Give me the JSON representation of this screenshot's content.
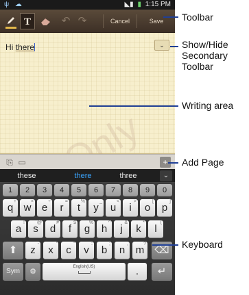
{
  "status_bar": {
    "time": "1:15 PM",
    "left_icons": "ψ ☁",
    "signal": "◣▮"
  },
  "toolbar": {
    "pen_icon": "pen-icon",
    "text_label": "T",
    "eraser_icon": "eraser-icon",
    "undo_icon": "undo-icon",
    "redo_icon": "redo-icon",
    "cancel_label": "Cancel",
    "save_label": "Save"
  },
  "writing": {
    "text_plain": "Hi ",
    "text_underlined": "there",
    "watermark": "Only",
    "chevron": "⌄"
  },
  "page_bar": {
    "icon_a": "⎘",
    "icon_b": "▭",
    "add_page_icon": "+"
  },
  "suggestions": [
    "these",
    "there",
    "three"
  ],
  "suggestion_expand": "⌄",
  "keyboard": {
    "numbers": [
      "1",
      "2",
      "3",
      "4",
      "5",
      "6",
      "7",
      "8",
      "9",
      "0"
    ],
    "row1": [
      {
        "k": "q",
        "s": "+"
      },
      {
        "k": "w",
        "s": "×"
      },
      {
        "k": "e",
        "s": "÷"
      },
      {
        "k": "r",
        "s": "="
      },
      {
        "k": "t",
        "s": "%"
      },
      {
        "k": "y",
        "s": "_"
      },
      {
        "k": "u",
        "s": "<"
      },
      {
        "k": "i",
        "s": ">"
      },
      {
        "k": "o",
        "s": "["
      },
      {
        "k": "p",
        "s": "]"
      }
    ],
    "row2": [
      {
        "k": "a",
        "s": "!"
      },
      {
        "k": "s",
        "s": "@"
      },
      {
        "k": "d",
        "s": "#"
      },
      {
        "k": "f",
        "s": "$"
      },
      {
        "k": "g",
        "s": "%"
      },
      {
        "k": "h",
        "s": "^"
      },
      {
        "k": "j",
        "s": "&"
      },
      {
        "k": "k",
        "s": "*"
      },
      {
        "k": "l",
        "s": "("
      }
    ],
    "row3": [
      {
        "k": "z",
        "s": "-"
      },
      {
        "k": "x",
        "s": "'"
      },
      {
        "k": "c",
        "s": "\""
      },
      {
        "k": "v",
        "s": ":"
      },
      {
        "k": "b",
        "s": ";"
      },
      {
        "k": "n",
        "s": ","
      },
      {
        "k": "m",
        "s": "?"
      }
    ],
    "shift": "⬆",
    "backspace": "⌫",
    "sym": "Sym",
    "settings": "⚙",
    "space_label": "English(US)",
    "period": ".",
    "enter": "↵"
  },
  "callouts": [
    {
      "id": "toolbar",
      "label": "Toolbar"
    },
    {
      "id": "secondary",
      "label": "Show/Hide Secondary Toolbar"
    },
    {
      "id": "writing",
      "label": "Writing area"
    },
    {
      "id": "addpage",
      "label": "Add Page"
    },
    {
      "id": "keyboard",
      "label": "Keyboard"
    }
  ],
  "colors": {
    "accent_blue": "#1f3f96",
    "suggest_highlight": "#3aa5ff",
    "paper": "#f7efcd"
  }
}
